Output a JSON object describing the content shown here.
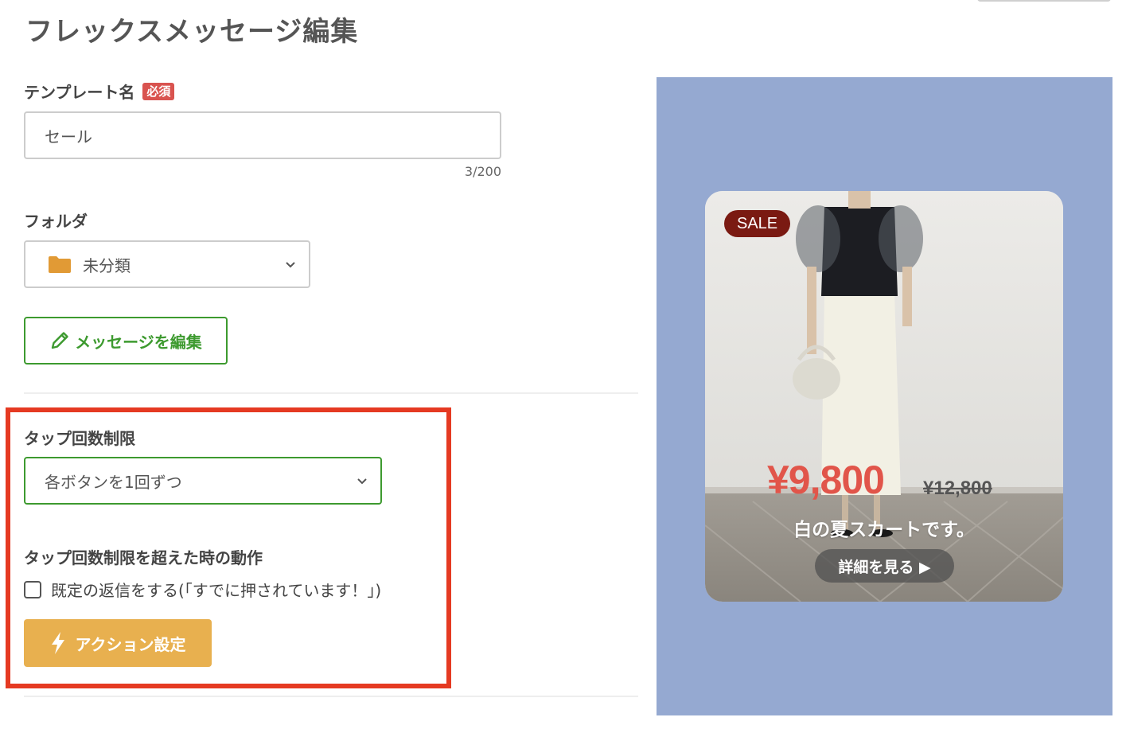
{
  "page": {
    "title": "フレックスメッセージ編集"
  },
  "template_name": {
    "label": "テンプレート名",
    "required_badge": "必須",
    "value": "セール",
    "char_count": "3/200"
  },
  "folder": {
    "label": "フォルダ",
    "selected": "未分類",
    "icon": "folder-icon",
    "icon_color": "#e19a35"
  },
  "edit_message": {
    "label": "メッセージを編集",
    "icon": "pencil-icon",
    "color": "#3d9a2f"
  },
  "tap_limit": {
    "label": "タップ回数制限",
    "selected": "各ボタンを1回ずつ",
    "exceed_label": "タップ回数制限を超えた時の動作",
    "checkbox_label": "既定の返信をする(「すでに押されています！」)",
    "checkbox_checked": false,
    "action_button": "アクション設定",
    "action_icon": "lightning-icon",
    "action_color": "#e8b04f",
    "highlight_color": "#e53a22"
  },
  "preview": {
    "background": "#95a9d1",
    "badge": "SALE",
    "price": "¥9,800",
    "original_price": "¥12,800",
    "description": "白の夏スカートです。",
    "detail_button": "詳細を見る ▶"
  }
}
